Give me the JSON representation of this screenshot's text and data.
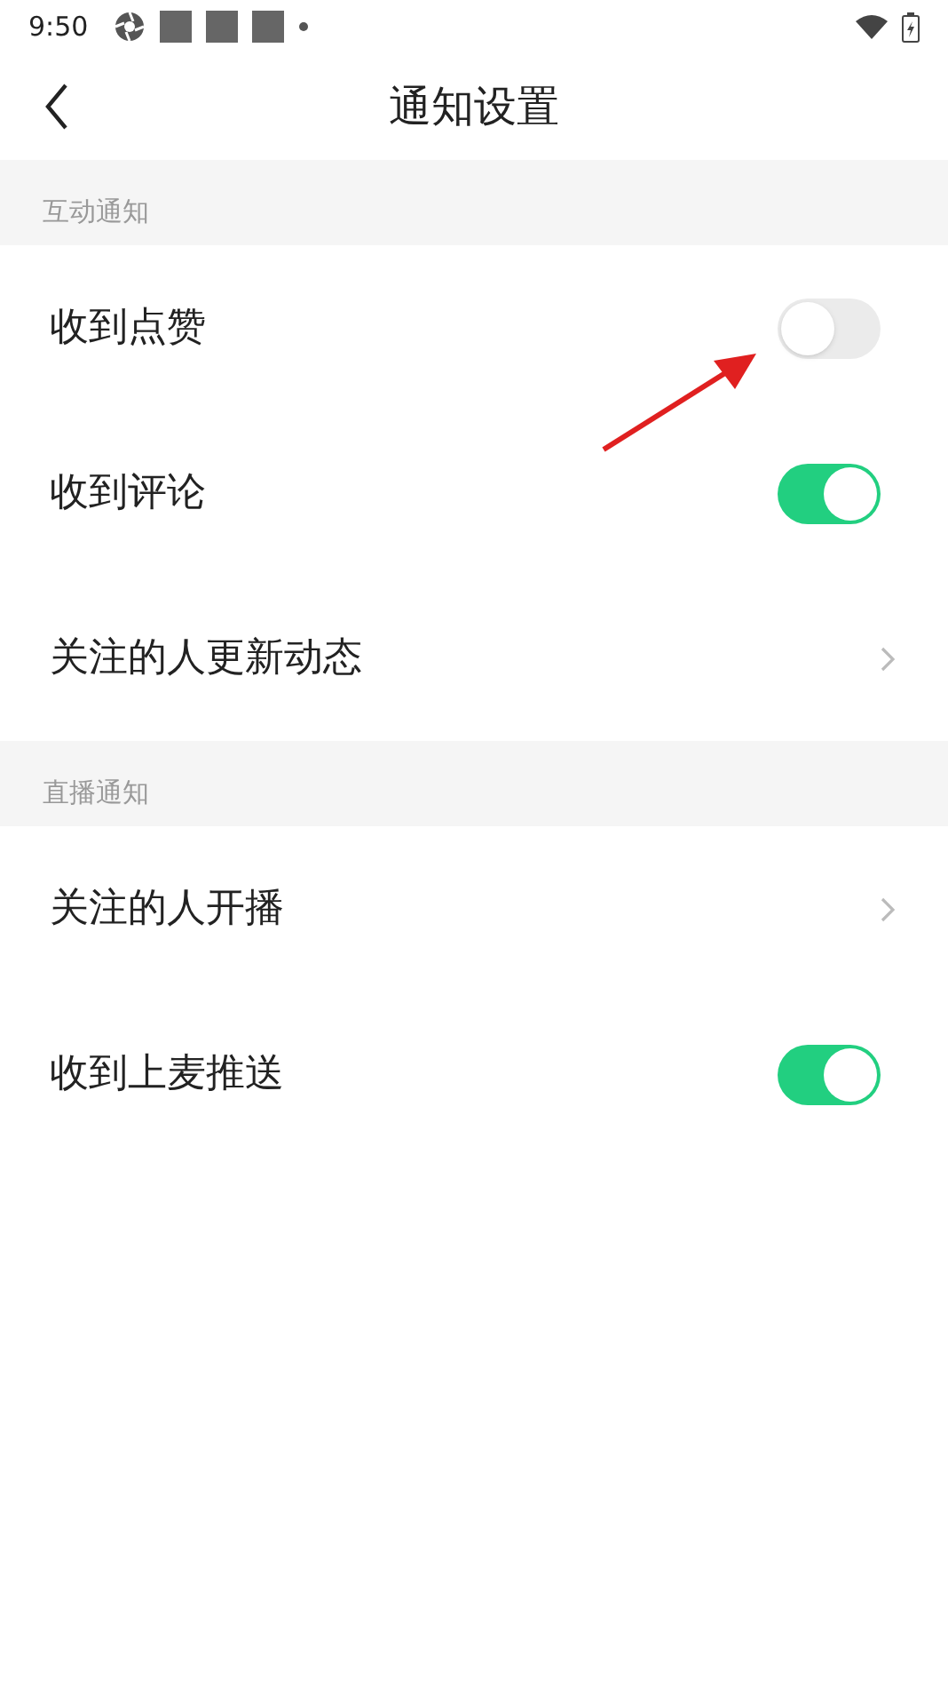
{
  "status_bar": {
    "time": "9:50"
  },
  "header": {
    "title": "通知设置"
  },
  "sections": [
    {
      "title": "互动通知",
      "rows": [
        {
          "kind": "toggle",
          "label": "收到点赞",
          "on": false
        },
        {
          "kind": "toggle",
          "label": "收到评论",
          "on": true
        },
        {
          "kind": "link",
          "label": "关注的人更新动态"
        }
      ]
    },
    {
      "title": "直播通知",
      "rows": [
        {
          "kind": "link",
          "label": "关注的人开播"
        },
        {
          "kind": "toggle",
          "label": "收到上麦推送",
          "on": true
        }
      ]
    }
  ]
}
